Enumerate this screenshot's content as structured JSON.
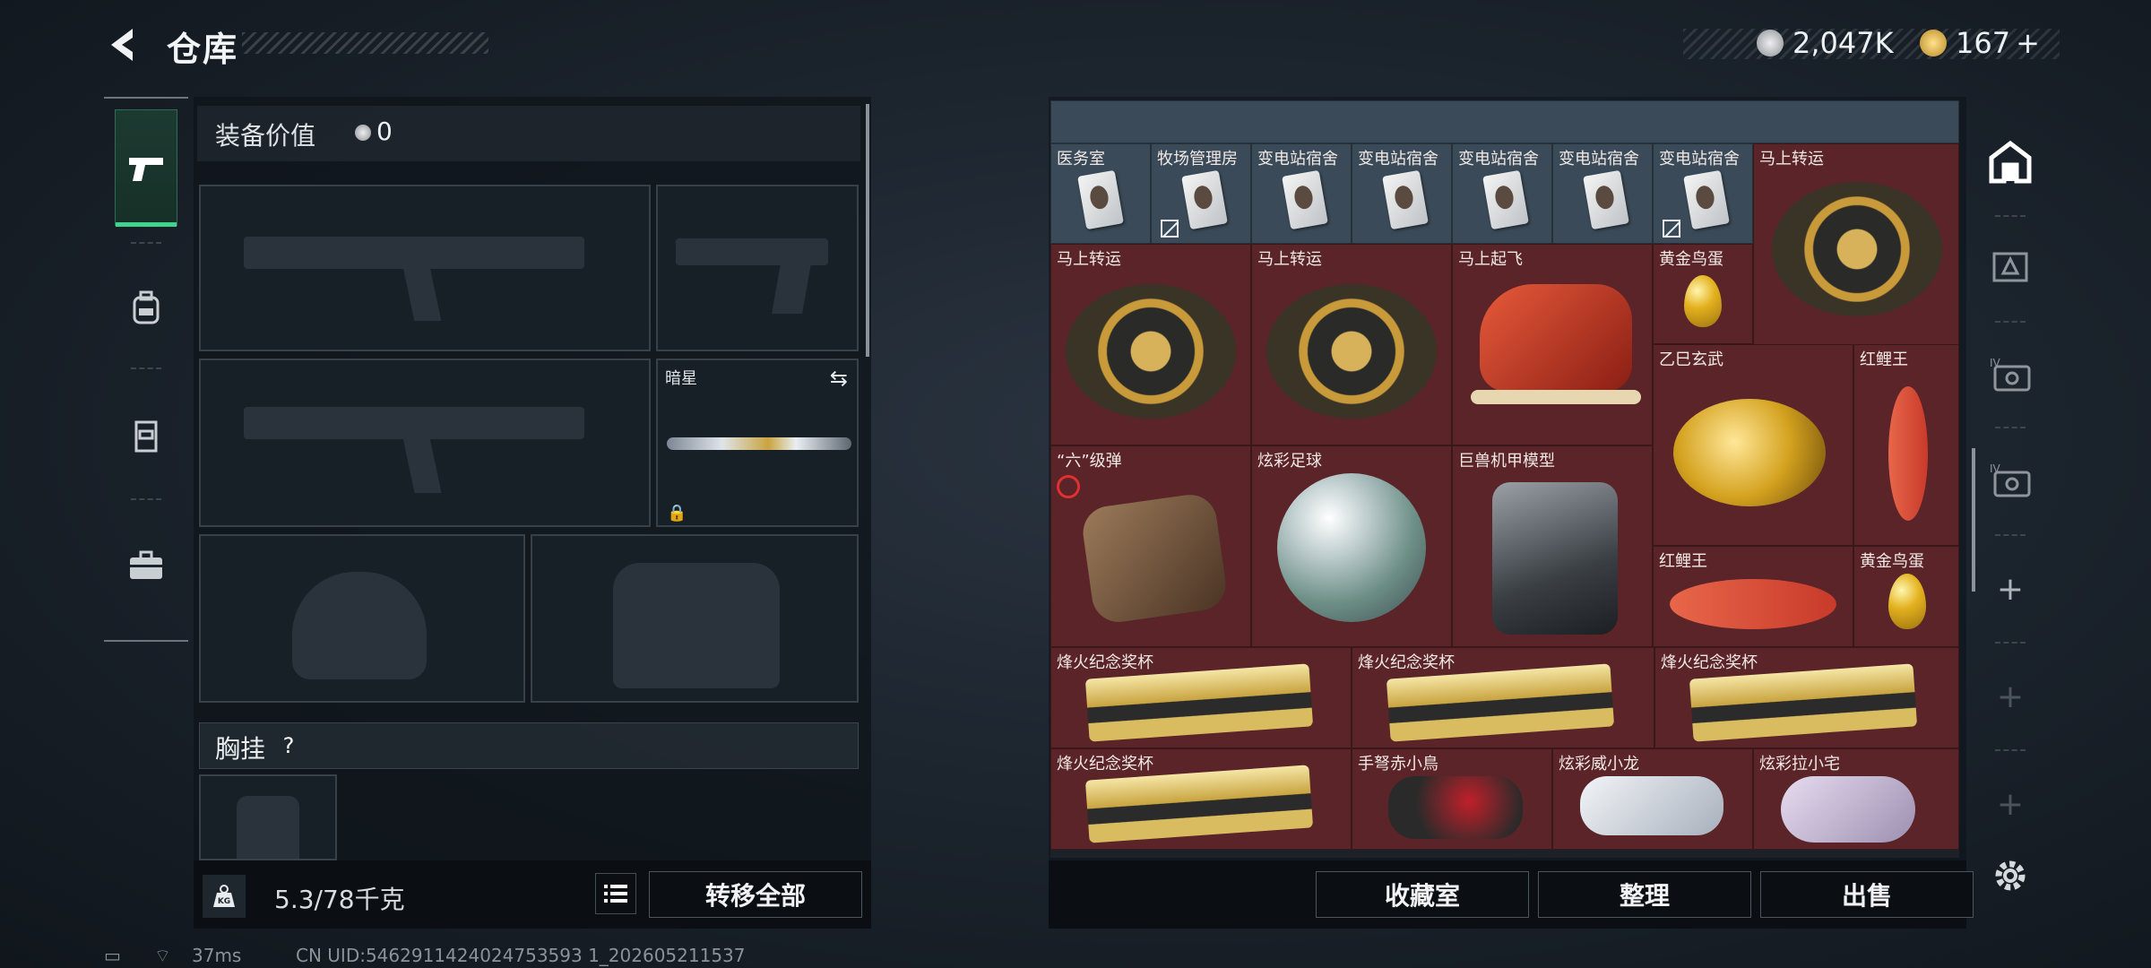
{
  "header": {
    "back_icon": "chevron-left-icon",
    "title": "仓库",
    "currency_silver": "2,047K",
    "currency_gold": "167",
    "gold_plus": "+",
    "colors": {
      "accent_green": "#3fd48f",
      "item_red": "#5a2428",
      "item_blue": "#3a4a58"
    }
  },
  "left_tabs": [
    {
      "icon": "pistol-icon",
      "active": true
    },
    {
      "icon": "backpack-icon",
      "active": false
    },
    {
      "icon": "vest-icon",
      "active": false
    },
    {
      "icon": "toolbox-icon",
      "active": false
    }
  ],
  "equipment": {
    "value_label": "装备价值",
    "value": "0",
    "knife_slot_label": "暗星",
    "chest_label": "胸挂",
    "chest_help": "?",
    "weight": "5.3/78千克",
    "transfer_all": "转移全部"
  },
  "stash": {
    "items": [
      {
        "label": "医务室"
      },
      {
        "label": "牧场管理房"
      },
      {
        "label": "变电站宿舍"
      },
      {
        "label": "变电站宿舍"
      },
      {
        "label": "变电站宿舍"
      },
      {
        "label": "变电站宿舍"
      },
      {
        "label": "变电站宿舍"
      },
      {
        "label": "马上转运"
      },
      {
        "label": "马上转运"
      },
      {
        "label": "马上转运"
      },
      {
        "label": "马上起飞"
      },
      {
        "label": "黄金鸟蛋"
      },
      {
        "label": "乙巳玄武"
      },
      {
        "label": "红鲤王"
      },
      {
        "label": "“六”级弹"
      },
      {
        "label": "炫彩足球"
      },
      {
        "label": "巨兽机甲模型"
      },
      {
        "label": "红鲤王"
      },
      {
        "label": "黄金鸟蛋"
      },
      {
        "label": "烽火纪念奖杯"
      },
      {
        "label": "烽火纪念奖杯"
      },
      {
        "label": "烽火纪念奖杯"
      },
      {
        "label": "烽火纪念奖杯"
      },
      {
        "label": "手弩赤小鳥"
      },
      {
        "label": "炫彩威小龙"
      },
      {
        "label": "炫彩拉小宅"
      }
    ]
  },
  "right_tools": [
    "home-icon",
    "crate-icon",
    "keycard-iv-icon",
    "keycard-iv-icon",
    "add-icon",
    "add-icon",
    "add-icon",
    "gear-icon"
  ],
  "actions": {
    "collection": "收藏室",
    "sort": "整理",
    "sell": "出售"
  },
  "status_bar": {
    "ping": "37ms",
    "uid": "CN UID:5462911424024753593 1_202605211537"
  }
}
